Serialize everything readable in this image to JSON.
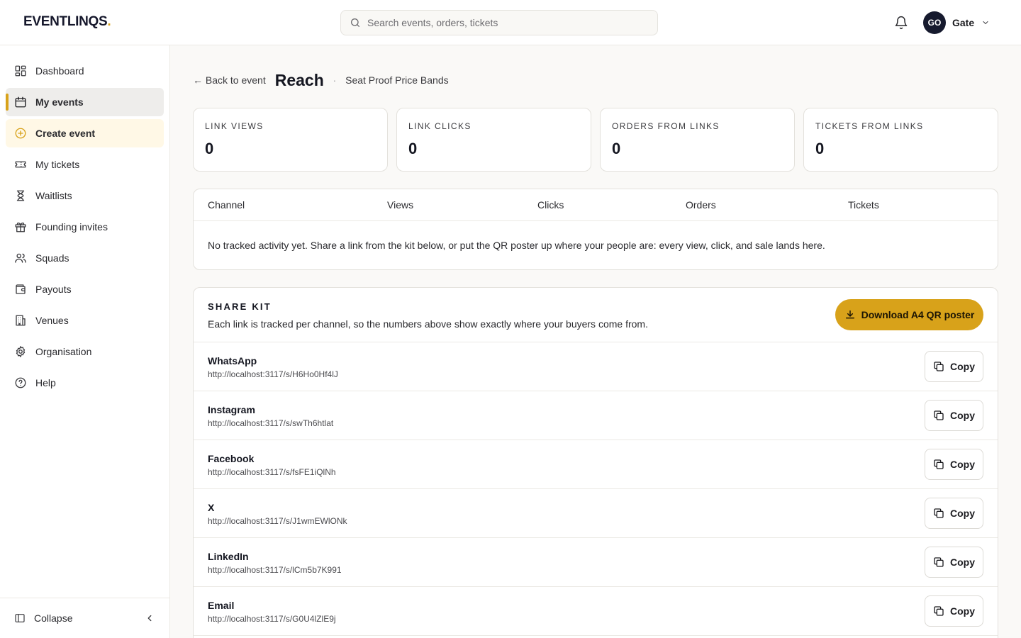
{
  "brand": {
    "name": "EVENTLINQS",
    "dot": ".",
    "accent": "#d8a21a"
  },
  "search": {
    "placeholder": "Search events, orders, tickets"
  },
  "user": {
    "initials": "GO",
    "name": "Gate"
  },
  "sidebar": {
    "items": [
      {
        "label": "Dashboard",
        "icon": "dashboard-icon"
      },
      {
        "label": "My events",
        "icon": "calendar-icon",
        "active": true
      },
      {
        "label": "Create event",
        "icon": "plus-circle-icon"
      },
      {
        "label": "My tickets",
        "icon": "ticket-icon"
      },
      {
        "label": "Waitlists",
        "icon": "hourglass-icon"
      },
      {
        "label": "Founding invites",
        "icon": "gift-icon"
      },
      {
        "label": "Squads",
        "icon": "users-icon"
      },
      {
        "label": "Payouts",
        "icon": "wallet-icon"
      },
      {
        "label": "Venues",
        "icon": "building-icon"
      },
      {
        "label": "Organisation",
        "icon": "gear-icon"
      },
      {
        "label": "Help",
        "icon": "help-icon"
      }
    ],
    "collapse_label": "Collapse"
  },
  "header": {
    "back_label": "← Back to event",
    "title": "Reach",
    "separator": "·",
    "event_name": "Seat Proof Price Bands"
  },
  "stats": [
    {
      "label": "LINK VIEWS",
      "value": "0"
    },
    {
      "label": "LINK CLICKS",
      "value": "0"
    },
    {
      "label": "ORDERS FROM LINKS",
      "value": "0"
    },
    {
      "label": "TICKETS FROM LINKS",
      "value": "0"
    }
  ],
  "table": {
    "columns": [
      "Channel",
      "Views",
      "Clicks",
      "Orders",
      "Tickets"
    ],
    "empty_message": "No tracked activity yet. Share a link from the kit below, or put the QR poster up where your people are: every view, click, and sale lands here."
  },
  "share_kit": {
    "title": "SHARE KIT",
    "subtitle": "Each link is tracked per channel, so the numbers above show exactly where your buyers come from.",
    "download_label": "Download A4 QR poster",
    "copy_label": "Copy",
    "channels": [
      {
        "name": "WhatsApp",
        "url": "http://localhost:3117/s/H6Ho0Hf4lJ"
      },
      {
        "name": "Instagram",
        "url": "http://localhost:3117/s/swTh6htlat"
      },
      {
        "name": "Facebook",
        "url": "http://localhost:3117/s/fsFE1iQlNh"
      },
      {
        "name": "X",
        "url": "http://localhost:3117/s/J1wmEWlONk"
      },
      {
        "name": "LinkedIn",
        "url": "http://localhost:3117/s/lCm5b7K991"
      },
      {
        "name": "Email",
        "url": "http://localhost:3117/s/G0U4lZlE9j"
      }
    ]
  }
}
